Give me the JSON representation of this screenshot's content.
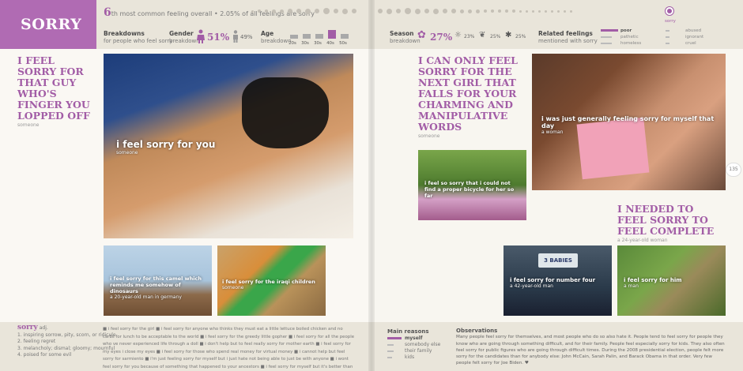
{
  "left_page": {
    "title": "SORRY",
    "rank": {
      "number": "6",
      "suffix": "th most common feeling overall",
      "detail": "• 2.05% of all feelings are sorry"
    },
    "breakdowns": {
      "title": "Breakdowns",
      "subtitle": "for people who feel sorry"
    },
    "gender": {
      "title": "Gender",
      "subtitle": "breakdown",
      "female": "51%",
      "male": "49%"
    },
    "age": {
      "title": "Age",
      "subtitle": "breakdown",
      "labels": [
        "20s",
        "30s",
        "30s",
        "40s",
        "50s"
      ],
      "values": [
        0.45,
        0.55,
        0.55,
        1.0,
        0.55
      ]
    },
    "headline": {
      "text": "I FEEL SORRY FOR THAT GUY WHO'S FINGER YOU LOPPED OFF",
      "by": "someone"
    },
    "main_photo": {
      "caption": "i feel sorry for you",
      "by": "someone"
    },
    "small_photo_1": {
      "caption": "i feel sorry for this camel which reminds me somehow of dinosaurs",
      "by": "a 20-year-old man in germany"
    },
    "small_photo_2": {
      "caption": "i feel sorry for the iraqi children",
      "by": "someone"
    },
    "definition": {
      "word": "sorry",
      "pos": "adj.",
      "senses": [
        "1. inspiring sorrow, pity, scorn, or ridicule",
        "2. feeling regret",
        "3. melancholy; dismal; gloomy; mournful",
        "4. poised for some evil"
      ]
    },
    "stream": "■ i feel sorry for the girl ■ i feel sorry for anyone who thinks they must eat a little lettuce boiled chicken and no carbs for lunch to be acceptable to the world ■ i feel sorry for the greedy little gopher ■ i feel sorry for all the people who ve never experienced life through a doll ■ i don't help but to feel really sorry for mother earth ■ i feel sorry for my eyes i close my eyes ■ i feel sorry for those who spend real money for virtual money ■ i cannot help but feel sorry for sarmiento ■ i'm just feeling sorry for myself but i just hate not being able to just be with anyone ■ i wont feel sorry for you because of something that happened to your ancestors ■ i feel sorry for myself but it's better than being"
  },
  "right_page": {
    "season": {
      "title": "Season",
      "subtitle": "breakdown",
      "values": [
        "27%",
        "23%",
        "25%",
        "25%"
      ]
    },
    "related": {
      "title": "Related feelings",
      "subtitle": "mentioned with sorry",
      "col1": [
        "poor",
        "pathetic",
        "homeless"
      ],
      "col2": [
        "abused",
        "ignorant",
        "cruel"
      ],
      "marker_label": "sorry"
    },
    "headline_1": {
      "text": "I CAN ONLY FEEL SORRY FOR THE NEXT GIRL THAT FALLS FOR YOUR CHARMING AND MANIPULATIVE WORDS",
      "by": "someone"
    },
    "photo_1": {
      "caption": "i was just generally feeling sorry for myself that day",
      "by": "a woman"
    },
    "photo_2": {
      "caption": "i feel so sorry that i could not find a proper bicycle for her so far",
      "by": ""
    },
    "headline_2": {
      "text": "I NEEDED TO FEEL SORRY TO FEEL COMPLETE",
      "by": "a 24-year-old woman"
    },
    "photo_3": {
      "caption": "i feel sorry for number four",
      "by": "a 42-year-old man",
      "plate": "3 BABIES"
    },
    "photo_4": {
      "caption": "i feel sorry for him",
      "by": "a man"
    },
    "page_number": "135",
    "main_reasons": {
      "title": "Main reasons",
      "items": [
        "myself",
        "somebody else",
        "their family",
        "kids"
      ]
    },
    "observations": {
      "title": "Observations",
      "text": "Many people feel sorry for themselves, and most people who do so also hate it. People tend to feel sorry for people they know who are going through something difficult, and for their family. People feel especially sorry for kids. They also often feel sorry for public figures who are going through difficult times. During the 2008 presidential election, people felt more sorry for the candidates than for anybody else: John McCain, Sarah Palin, and Barack Obama in that order. Very few people felt sorry for Joe Biden. ♥"
    }
  },
  "colors": {
    "accent": "#a25da6",
    "band": "#e9e5da"
  }
}
